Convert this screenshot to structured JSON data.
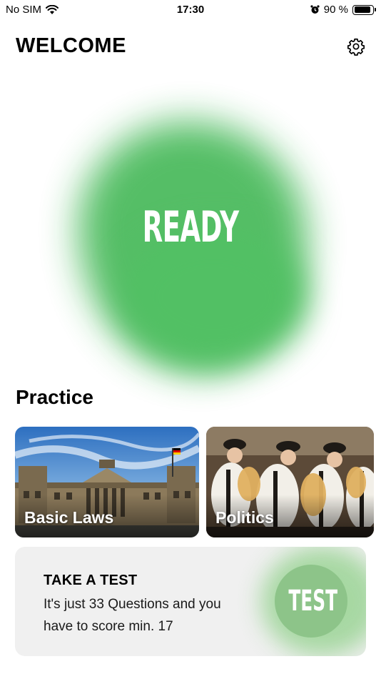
{
  "status_bar": {
    "carrier": "No SIM",
    "time": "17:30",
    "battery_text": "90 %",
    "battery_level": 0.9
  },
  "header": {
    "title": "WELCOME",
    "settings_icon": "gear-icon"
  },
  "hero": {
    "label": "READY",
    "color": "#4cbb5e"
  },
  "practice": {
    "title": "Practice",
    "cards": [
      {
        "label": "Basic Laws"
      },
      {
        "label": "Politics"
      }
    ]
  },
  "test_card": {
    "heading": "TAKE A TEST",
    "description": "It's just 33 Questions and you have to score min. 17",
    "button_label": "TEST",
    "accent": "#8dc489"
  }
}
